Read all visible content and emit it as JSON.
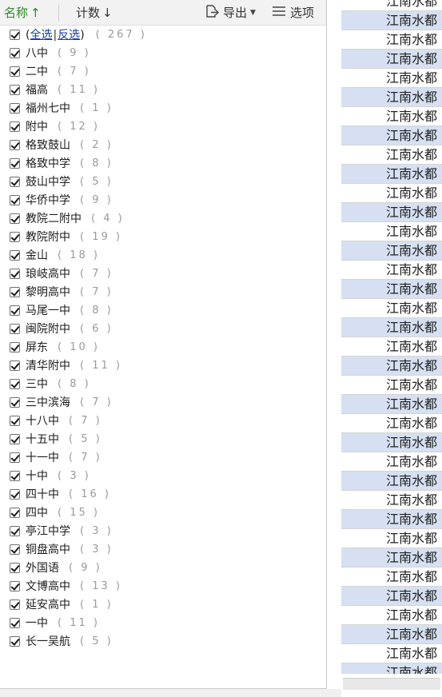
{
  "header": {
    "sort_name_label": "名称",
    "sort_name_arrow": "↑",
    "sort_count_label": "计数",
    "sort_count_arrow": "↓",
    "export_label": "导出",
    "options_label": "选项",
    "accent_color": "#2f8a2a"
  },
  "select_all": {
    "all": "全选",
    "invert": "反选",
    "total": "( 267 )"
  },
  "items": [
    {
      "label": "八中",
      "count": "( 9 )"
    },
    {
      "label": "二中",
      "count": "( 7 )"
    },
    {
      "label": "福高",
      "count": "( 11 )"
    },
    {
      "label": "福州七中",
      "count": "( 1 )"
    },
    {
      "label": "附中",
      "count": "( 12 )"
    },
    {
      "label": "格致鼓山",
      "count": "( 2 )"
    },
    {
      "label": "格致中学",
      "count": "( 8 )"
    },
    {
      "label": "鼓山中学",
      "count": "( 5 )"
    },
    {
      "label": "华侨中学",
      "count": "( 9 )"
    },
    {
      "label": "教院二附中",
      "count": "( 4 )"
    },
    {
      "label": "教院附中",
      "count": "( 19 )"
    },
    {
      "label": "金山",
      "count": "( 18 )"
    },
    {
      "label": "琅岐高中",
      "count": "( 7 )"
    },
    {
      "label": "黎明高中",
      "count": "( 7 )"
    },
    {
      "label": "马尾一中",
      "count": "( 8 )"
    },
    {
      "label": "闽院附中",
      "count": "( 6 )"
    },
    {
      "label": "屏东",
      "count": "( 10 )"
    },
    {
      "label": "清华附中",
      "count": "( 11 )"
    },
    {
      "label": "三中",
      "count": "( 8 )"
    },
    {
      "label": "三中滨海",
      "count": "( 7 )"
    },
    {
      "label": "十八中",
      "count": "( 7 )"
    },
    {
      "label": "十五中",
      "count": "( 5 )"
    },
    {
      "label": "十一中",
      "count": "( 7 )"
    },
    {
      "label": "十中",
      "count": "( 3 )"
    },
    {
      "label": "四十中",
      "count": "( 16 )"
    },
    {
      "label": "四中",
      "count": "( 15 )"
    },
    {
      "label": "亭江中学",
      "count": "( 3 )"
    },
    {
      "label": "铜盘高中",
      "count": "( 3 )"
    },
    {
      "label": "外国语",
      "count": "( 9 )"
    },
    {
      "label": "文博高中",
      "count": "( 13 )"
    },
    {
      "label": "延安高中",
      "count": "( 1 )"
    },
    {
      "label": "一中",
      "count": "( 11 )"
    },
    {
      "label": "长一吴航",
      "count": "( 5 )"
    }
  ],
  "cells": [
    "江南水都",
    "江南水都",
    "江南水都",
    "江南水都",
    "江南水都",
    "江南水都",
    "江南水都",
    "江南水都",
    "江南水都",
    "江南水都",
    "江南水都",
    "江南水都",
    "江南水都",
    "江南水都",
    "江南水都",
    "江南水都",
    "江南水都",
    "江南水都",
    "江南水都",
    "江南水都",
    "江南水都",
    "江南水都",
    "江南水都",
    "江南水都",
    "江南水都",
    "江南水都",
    "江南水都",
    "江南水都",
    "江南水都",
    "江南水都",
    "江南水都",
    "江南水都",
    "江南水都",
    "江南水都",
    "江南水都",
    "江南水都"
  ],
  "highlight_color": "#d6e0f2"
}
